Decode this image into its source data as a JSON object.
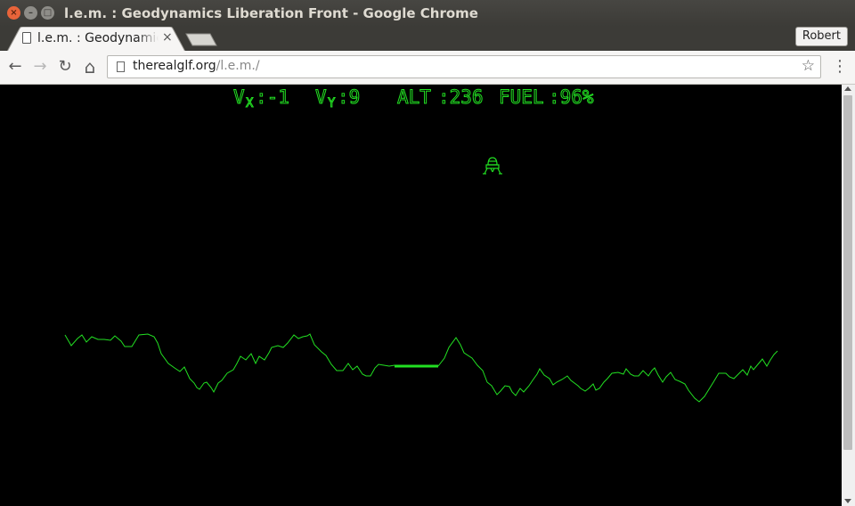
{
  "window": {
    "title": "l.e.m. : Geodynamics Liberation Front - Google Chrome",
    "close_glyph": "×",
    "min_glyph": "–",
    "max_glyph": "□"
  },
  "tab": {
    "title": "l.e.m. : Geodynamics Liberation Front",
    "close_glyph": "×"
  },
  "profile": {
    "name": "Robert"
  },
  "toolbar": {
    "back_glyph": "←",
    "forward_glyph": "→",
    "reload_glyph": "↻",
    "home_glyph": "⌂",
    "star_glyph": "☆",
    "menu_glyph": "⋮"
  },
  "address": {
    "host": "therealglf.org",
    "path": "/l.e.m./"
  },
  "hud": {
    "vx_label": "V",
    "vx_sub": "X",
    "vx_value": ":-1",
    "vy_label": "V",
    "vy_sub": "Y",
    "vy_value": ":9",
    "alt_label": "ALT",
    "alt_value": ":236",
    "fuel_label": "FUEL",
    "fuel_value": ":96%"
  },
  "colors": {
    "vector_green": "#22e022",
    "background": "#000000"
  },
  "icons": [
    "page-icon",
    "back-arrow-icon",
    "forward-arrow-icon",
    "reload-icon",
    "home-icon",
    "bookmark-star-icon",
    "menu-icon",
    "lunar-module-icon"
  ]
}
